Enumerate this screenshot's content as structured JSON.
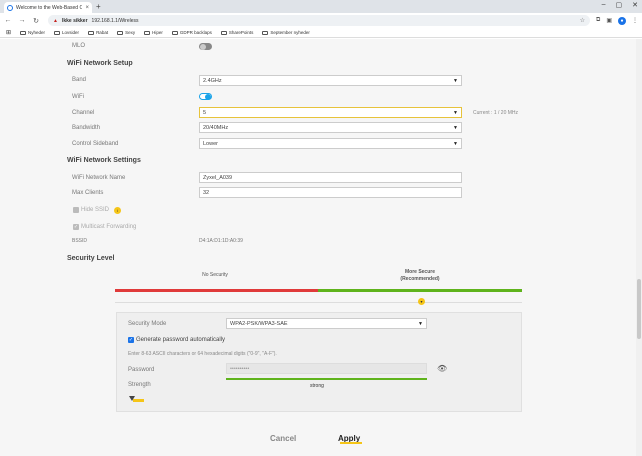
{
  "browser": {
    "tab_title": "Welcome to the Web-Based Configurator",
    "new_tab": "+",
    "security_label": "Ikke sikker",
    "url": "192.168.1.1/Wireless",
    "bookmarks": [
      "Nyheder",
      "Lovsider",
      "Rabat",
      "Sexy",
      "Hiper",
      "GDPR backlaps",
      "SharePoints",
      "September nyheder"
    ]
  },
  "mlo": {
    "label": "MLO",
    "enabled": false
  },
  "wifi_setup": {
    "heading": "WiFi Network Setup",
    "band_label": "Band",
    "band_value": "2.4GHz",
    "wifi_label": "WiFi",
    "wifi_enabled": true,
    "channel_label": "Channel",
    "channel_value": "5",
    "channel_current": "Current : 1 / 20 MHz",
    "bandwidth_label": "Bandwidth",
    "bandwidth_value": "20/40MHz",
    "sideband_label": "Control Sideband",
    "sideband_value": "Lower"
  },
  "wifi_settings": {
    "heading": "WiFi Network Settings",
    "name_label": "WiFi Network Name",
    "name_value": "Zyxel_A039",
    "clients_label": "Max Clients",
    "clients_value": "32",
    "hide_ssid_label": "Hide SSID",
    "multicast_label": "Multicast Forwarding",
    "bssid_label": "BSSID",
    "bssid_value": "D4:1A:D1:1D:A0:39"
  },
  "security": {
    "heading": "Security Level",
    "no_security": "No Security",
    "more_secure": "More Secure",
    "recommended": "(Recommended)",
    "mode_label": "Security Mode",
    "mode_value": "WPA2-PSK/WPA3-SAE",
    "generate_label": "Generate password automatically",
    "hint": "Enter 8-63 ASCII characters or 64 hexadecimal digits (\"0-9\", \"A-F\").",
    "password_label": "Password",
    "password_value": "••••••••••",
    "strength_label": "Strength",
    "strength_value": "strong"
  },
  "actions": {
    "cancel": "Cancel",
    "apply": "Apply"
  },
  "colors": {
    "accent": "#1aa3e8",
    "red": "#e03a3a",
    "green": "#5fb31c",
    "yellow": "#f5c518"
  }
}
